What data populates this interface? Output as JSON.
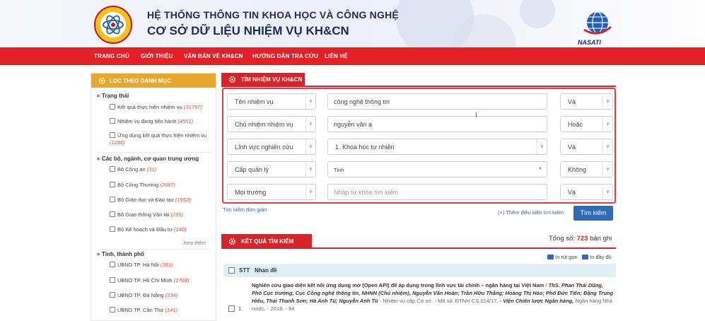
{
  "header": {
    "title_line1": "HỆ THỐNG THÔNG TIN KHOA HỌC VÀ CÔNG NGHỆ",
    "title_line2": "CƠ SỞ DỮ LIỆU NHIỆM VỤ KH&CN",
    "right_logo_text": "NASATI"
  },
  "nav": [
    "TRANG CHỦ",
    "GIỚI THIỆU",
    "VĂN BẢN VỀ KH&CN",
    "HƯỚNG DẪN TRA CỨU",
    "LIÊN HỆ"
  ],
  "sidebar": {
    "heading": "LỌC THEO DANH MỤC",
    "groups": [
      {
        "title": "Trạng thái",
        "items": [
          {
            "label": "Kết quả thực hiện nhiệm vụ",
            "count": "(31797)"
          },
          {
            "label": "Nhiệm vụ đang tiến hành",
            "count": "(4551)"
          },
          {
            "label": "Ứng dụng kết quả thực hiện nhiệm vụ",
            "count": "(1286)"
          }
        ]
      },
      {
        "title": "Các bộ, ngành, cơ quan trung ương",
        "items": [
          {
            "label": "Bộ Công an",
            "count": "(31)"
          },
          {
            "label": "Bộ Công Thương",
            "count": "(2667)"
          },
          {
            "label": "Bộ Giáo dục và Đào tạo",
            "count": "(1952)"
          },
          {
            "label": "Bộ Giao thông Vận tải",
            "count": "(295)"
          },
          {
            "label": "Bộ Kế hoạch và Đầu tư",
            "count": "(240)"
          }
        ],
        "more": "Xem thêm"
      },
      {
        "title": "Tỉnh, thành phố",
        "items": [
          {
            "label": "UBND TP. Hà Nội",
            "count": "(381)"
          },
          {
            "label": "UBND TP. Hồ Chí Minh",
            "count": "(1768)"
          },
          {
            "label": "UBND TP. Đà Nẵng",
            "count": "(334)"
          },
          {
            "label": "UBND TP. Cần Thơ",
            "count": "(141)"
          }
        ]
      }
    ]
  },
  "search": {
    "heading": "TÌM NHIỆM VỤ KH&CN",
    "rows": [
      {
        "field": "Tên nhiệm vụ",
        "value": "công nghệ thông tin",
        "op": "Và"
      },
      {
        "field": "Chủ nhiệm nhiệm vụ",
        "value": "nguyễn văn a",
        "op": "Hoặc"
      },
      {
        "field": "Lĩnh vực nghiên cứu",
        "value": "1. Khoa học tự nhiên",
        "op": "Và"
      },
      {
        "field": "Cấp quản lý",
        "value": "Tỉnh",
        "op": "Không"
      },
      {
        "field": "Mọi trường",
        "placeholder": "Nhập từ khóa tìm kiếm",
        "op": "Và"
      }
    ],
    "simple_link": "Tìm kiếm đơn giản",
    "add_condition": "(+) Thêm điều kiện tìm kiếm",
    "submit": "Tìm kiếm"
  },
  "results": {
    "heading": "KẾT QUẢ TÌM KIẾM",
    "total_prefix": "Tổng số:",
    "total_count": "723",
    "total_suffix": "bản ghi",
    "print_short": "In rút gọn",
    "print_full": "In đầy đủ",
    "col_stt": "STT",
    "col_title": "Nhan đề",
    "rows": [
      {
        "stt": "1",
        "title": "Nghiên cứu giao diện kết nối ứng dụng mở (Open API) để áp dụng trong lĩnh vực tài chính – ngân hàng tại Việt Nam",
        "authors": "ThS. Phan Thái Dũng, Phó Cục trưởng, Cục Công nghệ thông tin, NHNN (Chủ nhiệm), Nguyễn Văn Hoàn; Trần Hữu Thắng; Hoàng Thị Hảo; Phó Đức Tiến; Đặng Trung Hiếu, Thái Thanh Sơn; Hà Anh Tú; Nguyễn Anh Tú",
        "meta": "- Nhiệm vụ cấp Cơ sở. - Mã số: ĐTNH-CS.014/17.",
        "org": "- Viện Chiến lược Ngân hàng, ",
        "org2": "Ngân hàng Nhà nước. - 2019. - 94"
      }
    ]
  },
  "colors": {
    "red": "#d9232a",
    "orange": "#e8a62c",
    "blue": "#2f6bb8",
    "navy": "#1f2a5f"
  }
}
